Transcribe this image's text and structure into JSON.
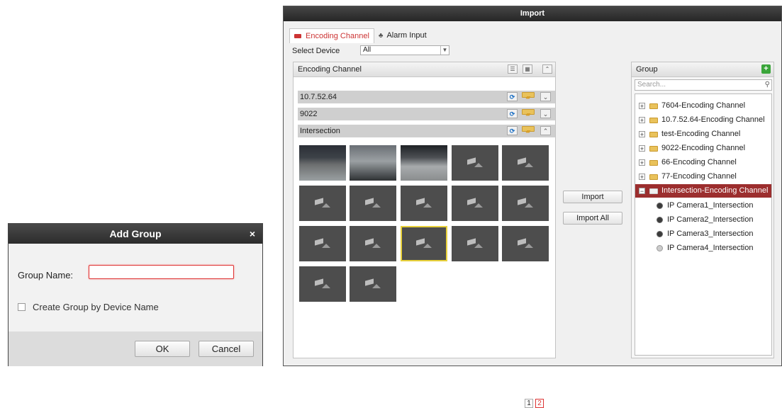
{
  "add_group": {
    "title": "Add Group",
    "close": "×",
    "group_name_label": "Group Name:",
    "group_name_value": "",
    "create_by_device_label": "Create Group by Device Name",
    "create_by_device_checked": false,
    "ok_label": "OK",
    "cancel_label": "Cancel"
  },
  "import_window": {
    "title": "Import",
    "tabs": [
      {
        "label": "Encoding Channel",
        "active": true,
        "icon": "encoding-channel-icon"
      },
      {
        "label": "Alarm Input",
        "active": false,
        "icon": "alarm-input-icon"
      }
    ],
    "select_device_label": "Select Device",
    "select_device_value": "All",
    "left_panel": {
      "header": "Encoding Channel",
      "devices": [
        {
          "name": "10.7.52.64",
          "expanded": false
        },
        {
          "name": "9022",
          "expanded": false
        },
        {
          "name": "Intersection",
          "expanded": true
        }
      ],
      "pages": [
        "1",
        "2"
      ],
      "active_page": "2"
    },
    "import_label": "Import",
    "import_all_label": "Import All",
    "right_panel": {
      "header": "Group",
      "search_placeholder": "Search...",
      "groups": [
        {
          "label": "7604-Encoding Channel"
        },
        {
          "label": "10.7.52.64-Encoding Channel"
        },
        {
          "label": "test-Encoding Channel"
        },
        {
          "label": "9022-Encoding Channel"
        },
        {
          "label": "66-Encoding Channel"
        },
        {
          "label": "77-Encoding Channel"
        },
        {
          "label": "Intersection-Encoding Channel",
          "selected": true
        }
      ],
      "cameras": [
        {
          "label": "IP Camera1_Intersection",
          "online": true
        },
        {
          "label": "IP Camera2_Intersection",
          "online": true
        },
        {
          "label": "IP Camera3_Intersection",
          "online": true
        },
        {
          "label": "IP Camera4_Intersection",
          "online": false
        }
      ]
    }
  },
  "colors": {
    "accent": "#c33333",
    "selected_row": "#9c2e2e",
    "title_bar": "#2c2c2c"
  }
}
